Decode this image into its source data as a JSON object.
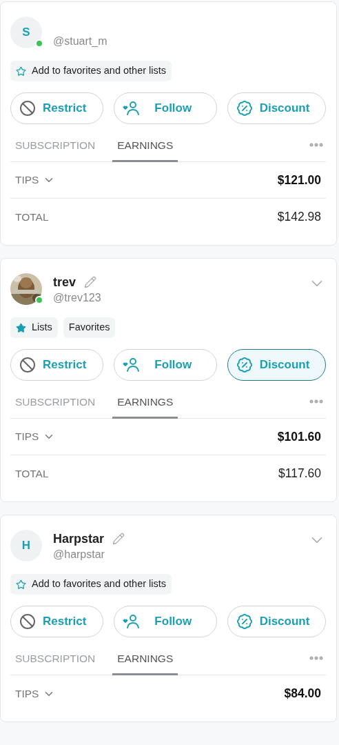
{
  "cards": [
    {
      "avatar": {
        "kind": "letter",
        "letter": "S"
      },
      "online": true,
      "handle": "@stuart_m",
      "chips": [
        {
          "kind": "add",
          "label": "Add to favorites and other lists"
        }
      ],
      "buttons": [
        {
          "kind": "restrict",
          "label": "Restrict",
          "selected": false
        },
        {
          "kind": "follow",
          "label": "Follow",
          "selected": false
        },
        {
          "kind": "discount",
          "label": "Discount",
          "selected": false
        }
      ],
      "tabs": [
        {
          "label": "SUBSCRIPTION",
          "selected": false
        },
        {
          "label": "EARNINGS",
          "selected": true
        }
      ],
      "rows": [
        {
          "label": "TIPS",
          "value": "$121.00",
          "expandable": true
        },
        {
          "label": "TOTAL",
          "value": "$142.98",
          "expandable": false
        }
      ]
    },
    {
      "avatar": {
        "kind": "picture"
      },
      "online": true,
      "name": "trev",
      "handle": "@trev123",
      "chips": [
        {
          "kind": "lists",
          "label": "Lists"
        },
        {
          "kind": "plain",
          "label": "Favorites"
        }
      ],
      "buttons": [
        {
          "kind": "restrict",
          "label": "Restrict",
          "selected": false
        },
        {
          "kind": "follow",
          "label": "Follow",
          "selected": false
        },
        {
          "kind": "discount",
          "label": "Discount",
          "selected": true
        }
      ],
      "tabs": [
        {
          "label": "SUBSCRIPTION",
          "selected": false
        },
        {
          "label": "EARNINGS",
          "selected": true
        }
      ],
      "rows": [
        {
          "label": "TIPS",
          "value": "$101.60",
          "expandable": true
        },
        {
          "label": "TOTAL",
          "value": "$117.60",
          "expandable": false
        }
      ]
    },
    {
      "avatar": {
        "kind": "letter",
        "letter": "H"
      },
      "online": false,
      "name": "Harpstar",
      "handle": "@harpstar",
      "chips": [
        {
          "kind": "add",
          "label": "Add to favorites and other lists"
        }
      ],
      "buttons": [
        {
          "kind": "restrict",
          "label": "Restrict",
          "selected": false
        },
        {
          "kind": "follow",
          "label": "Follow",
          "selected": false
        },
        {
          "kind": "discount",
          "label": "Discount",
          "selected": false
        }
      ],
      "tabs": [
        {
          "label": "SUBSCRIPTION",
          "selected": false
        },
        {
          "label": "EARNINGS",
          "selected": true
        }
      ],
      "rows": [
        {
          "label": "TIPS",
          "value": "$84.00",
          "expandable": true
        }
      ]
    }
  ]
}
